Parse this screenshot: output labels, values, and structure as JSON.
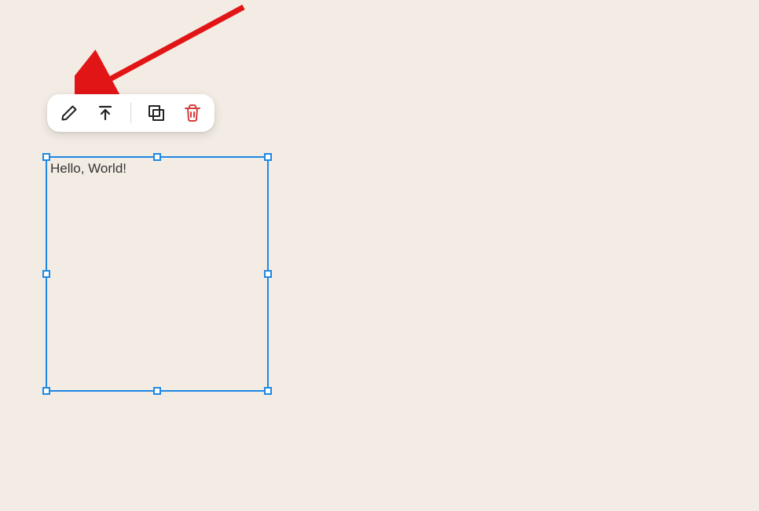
{
  "canvas": {
    "background": "#f3ece4",
    "text_content": "Hello, World!",
    "selection_color": "#1e88e5"
  },
  "toolbar": {
    "edit_label": "Edit",
    "bring_front_label": "Bring to front",
    "duplicate_label": "Duplicate",
    "delete_label": "Delete",
    "delete_color": "#d63c3c"
  },
  "annotation": {
    "arrow_color": "#e11515"
  }
}
